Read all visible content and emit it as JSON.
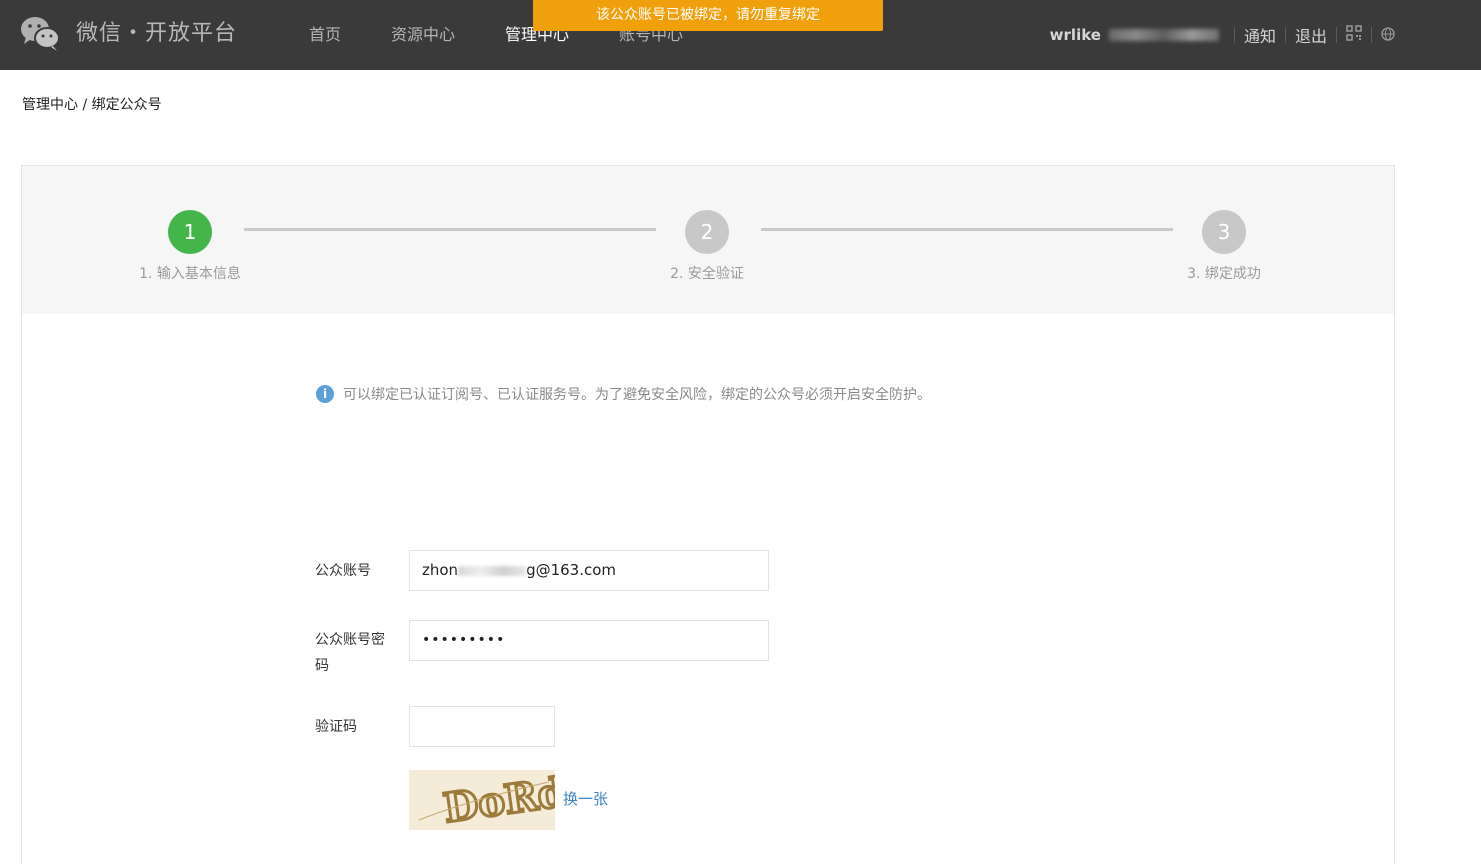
{
  "header": {
    "logo_text": "微信・开放平台",
    "nav": [
      {
        "label": "首页",
        "active": false
      },
      {
        "label": "资源中心",
        "active": false
      },
      {
        "label": "管理中心",
        "active": true
      },
      {
        "label": "账号中心",
        "active": false
      }
    ],
    "alert": "该公众账号已被绑定，请勿重复绑定",
    "username": "wrlike",
    "notify_label": "通知",
    "logout_label": "退出",
    "icons": {
      "qr": "qr-code-icon",
      "globe": "globe-icon",
      "logo": "wechat-logo-icon"
    }
  },
  "breadcrumb": "管理中心 / 绑定公众号",
  "steps": [
    {
      "number": "1",
      "label": "1. 输入基本信息",
      "status": "current"
    },
    {
      "number": "2",
      "label": "2. 安全验证",
      "status": "pending"
    },
    {
      "number": "3",
      "label": "3. 绑定成功",
      "status": "pending"
    }
  ],
  "tip": "可以绑定已认证订阅号、已认证服务号。为了避免安全风险，绑定的公众号必须开启安全防护。",
  "form": {
    "account_label": "公众账号",
    "account_value_prefix": "zhon",
    "account_value_suffix": "g@163.com",
    "password_label_line1": "公众账号密",
    "password_label_line2": "码",
    "password_value": "•••••••••",
    "captcha_label": "验证码",
    "captcha_value": "",
    "captcha_text": "DoRd",
    "refresh_label": "换一张"
  },
  "colors": {
    "header_bg": "#3a3a3a",
    "alert_bg": "#f0a00c",
    "step_active": "#44b549",
    "step_inactive": "#c8c8c8",
    "link": "#3e85c8"
  }
}
